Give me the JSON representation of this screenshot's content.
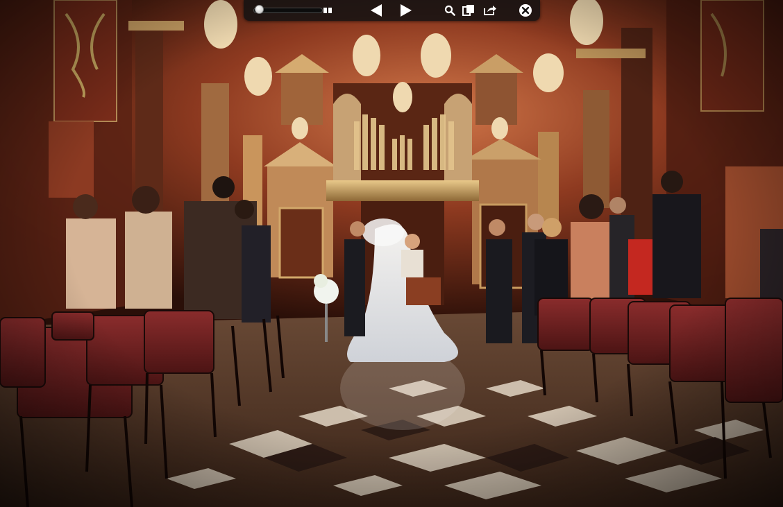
{
  "viewer": {
    "toolbar": {
      "zoom_slider_value": 0.0,
      "icons": {
        "thumbnails": "grid-thumbnails-icon",
        "previous": "previous-arrow-icon",
        "play": "play-slideshow-icon",
        "zoom": "magnifier-icon",
        "index_sheet": "index-sheet-icon",
        "share": "share-icon",
        "close": "close-icon"
      },
      "colors": {
        "bar": "#141212",
        "icon": "#ffffff"
      }
    },
    "image": {
      "subject": "wedding-ceremony-photo"
    }
  }
}
